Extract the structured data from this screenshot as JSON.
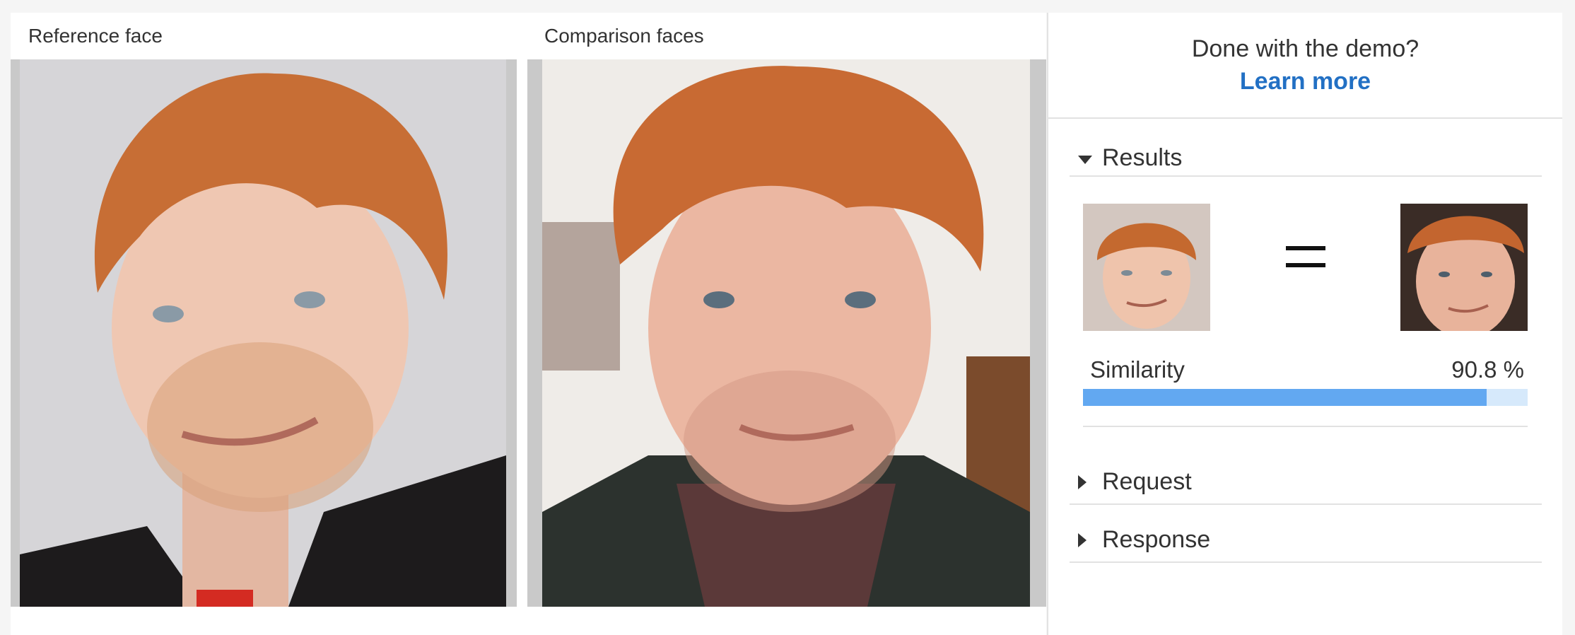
{
  "left": {
    "reference_label": "Reference face",
    "comparison_label": "Comparison faces"
  },
  "right": {
    "demo_title": "Done with the demo?",
    "learn_more": "Learn more",
    "results": {
      "label": "Results",
      "similarity_label": "Similarity",
      "similarity_value": "90.8 %",
      "similarity_fraction": 0.908
    },
    "request_label": "Request",
    "response_label": "Response"
  },
  "colors": {
    "link": "#2270c4",
    "bar_fill": "#62a8f1",
    "bar_track": "#d6e9fb"
  },
  "icons": [
    "caret-down-icon",
    "caret-right-icon",
    "equals-icon"
  ]
}
